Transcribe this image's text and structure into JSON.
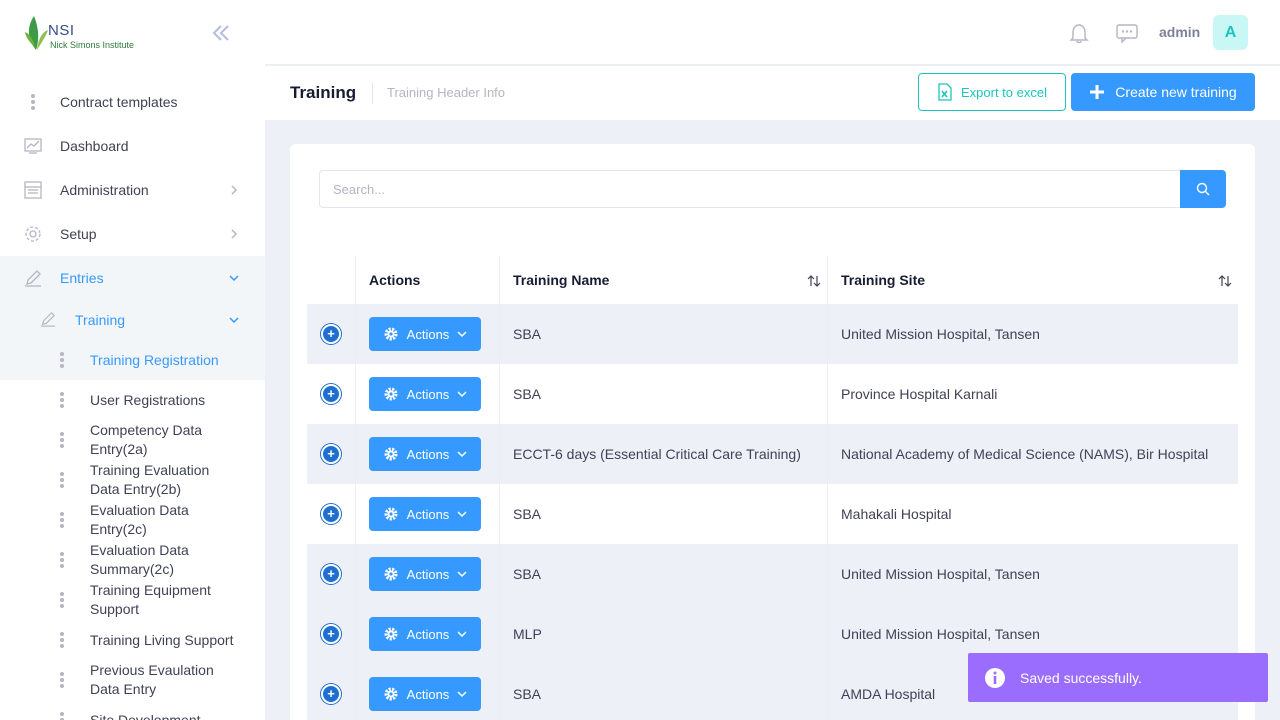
{
  "brand": {
    "name": "NSI",
    "subtitle": "Nick Simons Institute"
  },
  "topbar": {
    "user_name": "admin",
    "avatar_letter": "A"
  },
  "subheader": {
    "title": "Training",
    "subtitle": "Training Header Info",
    "export_label": "Export to excel",
    "create_label": "Create new training"
  },
  "sidebar": {
    "items": [
      {
        "label": "Contract templates",
        "icon": "dots-vertical-icon"
      },
      {
        "label": "Dashboard",
        "icon": "chart-icon"
      },
      {
        "label": "Administration",
        "icon": "layout-icon"
      },
      {
        "label": "Setup",
        "icon": "gear-icon"
      },
      {
        "label": "Entries",
        "icon": "pencil-icon"
      }
    ],
    "sub_group": {
      "label": "Training"
    },
    "leaves": [
      {
        "label": "Training Registration"
      },
      {
        "label": "User Registrations"
      },
      {
        "label": "Competency Data Entry(2a)"
      },
      {
        "label": "Training Evaluation Data Entry(2b)"
      },
      {
        "label": "Evaluation Data Entry(2c)"
      },
      {
        "label": "Evaluation Data Summary(2c)"
      },
      {
        "label": "Training Equipment Support"
      },
      {
        "label": "Training Living Support"
      },
      {
        "label": "Previous Evaulation Data Entry"
      },
      {
        "label": "Site Development"
      }
    ]
  },
  "search": {
    "placeholder": "Search..."
  },
  "table": {
    "columns": [
      "",
      "Actions",
      "Training Name",
      "Training Site"
    ],
    "action_label": "Actions",
    "rows": [
      {
        "name": "SBA",
        "site": "United Mission Hospital, Tansen"
      },
      {
        "name": "SBA",
        "site": "Province Hospital Karnali"
      },
      {
        "name": "ECCT-6 days (Essential Critical Care Training)",
        "site": "National Academy of Medical Science (NAMS), Bir Hospital"
      },
      {
        "name": "SBA",
        "site": "Mahakali Hospital"
      },
      {
        "name": "SBA",
        "site": "United Mission Hospital, Tansen"
      },
      {
        "name": "MLP",
        "site": "United Mission Hospital, Tansen"
      },
      {
        "name": "SBA",
        "site": "AMDA Hospital"
      }
    ]
  },
  "toast": {
    "message": "Saved successfully."
  },
  "colors": {
    "primary": "#3699ff",
    "teal": "#1bc5bd",
    "toast": "#9b6dff"
  }
}
